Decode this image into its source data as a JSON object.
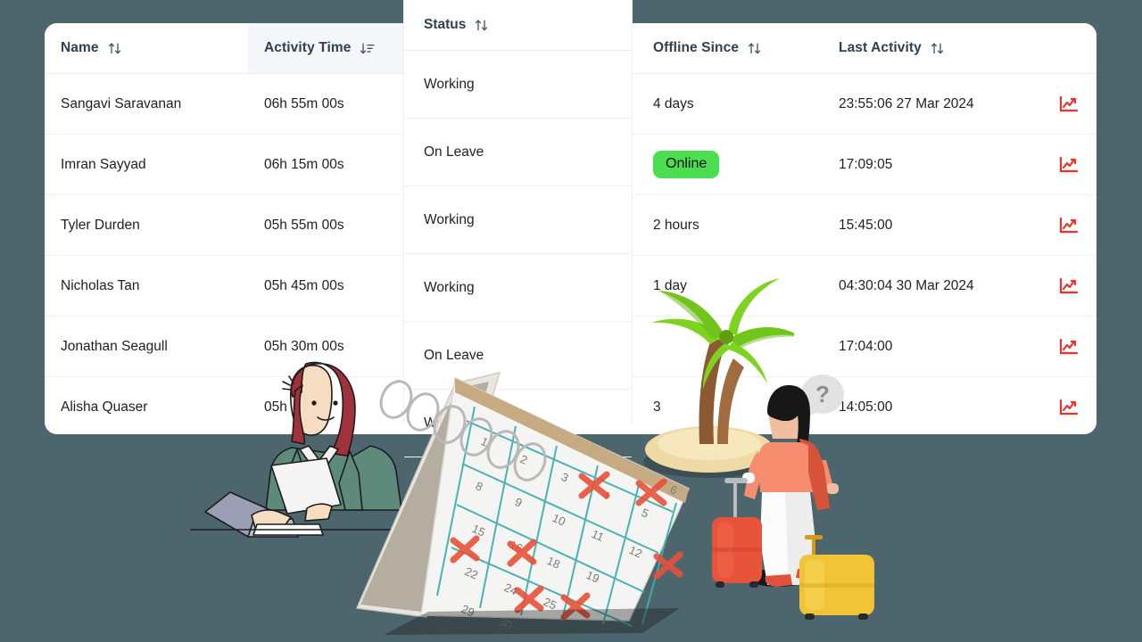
{
  "theme": {
    "background": "#4d666e",
    "card_background": "#ffffff",
    "header_text": "#2f4050",
    "header_tint": "#f4f6f9",
    "row_divider": "#eef1f5",
    "online_badge_bg": "#4ade50",
    "chart_icon_color": "#e8322a"
  },
  "table": {
    "columns": [
      {
        "key": "name",
        "label": "Name",
        "sort_icon": "sort-updown-icon",
        "tinted": false
      },
      {
        "key": "activity_time",
        "label": "Activity Time",
        "sort_icon": "sort-descending-icon",
        "tinted": true
      },
      {
        "key": "status",
        "label": "Status",
        "sort_icon": "sort-updown-icon",
        "tinted": false
      },
      {
        "key": "offline_since",
        "label": "Offline Since",
        "sort_icon": "sort-updown-icon",
        "tinted": false
      },
      {
        "key": "last_activity",
        "label": "Last Activity",
        "sort_icon": "sort-updown-icon",
        "tinted": false
      },
      {
        "key": "chart",
        "label": "",
        "sort_icon": "",
        "tinted": false
      }
    ],
    "rows": [
      {
        "name": "Sangavi Saravanan",
        "activity_time": "06h 55m 00s",
        "status": "Working",
        "offline_since": "4 days",
        "offline_is_badge": false,
        "last_activity": "23:55:06 27 Mar 2024",
        "chart_icon": "line-chart-icon"
      },
      {
        "name": "Imran Sayyad",
        "activity_time": "06h 15m 00s",
        "status": "On Leave",
        "offline_since": "Online",
        "offline_is_badge": true,
        "last_activity": "17:09:05",
        "chart_icon": "line-chart-icon"
      },
      {
        "name": "Tyler Durden",
        "activity_time": "05h 55m 00s",
        "status": "Working",
        "offline_since": "2 hours",
        "offline_is_badge": false,
        "last_activity": "15:45:00",
        "chart_icon": "line-chart-icon"
      },
      {
        "name": "Nicholas Tan",
        "activity_time": "05h 45m 00s",
        "status": "Working",
        "offline_since": "1 day",
        "offline_is_badge": false,
        "last_activity": "04:30:04 30 Mar 2024",
        "chart_icon": "line-chart-icon"
      },
      {
        "name": "Jonathan Seagull",
        "activity_time": "05h 30m 00s",
        "status": "On Leave",
        "offline_since": "",
        "offline_is_badge": false,
        "last_activity": "17:04:00",
        "chart_icon": "line-chart-icon"
      },
      {
        "name": "Alisha Quaser",
        "activity_time": "05h 05m",
        "status": "Working",
        "offline_since": "3",
        "offline_is_badge": false,
        "last_activity": "14:05:00",
        "chart_icon": "line-chart-icon"
      }
    ]
  },
  "status_panel": {
    "header_label": "Status",
    "sort_icon": "sort-updown-icon",
    "values": [
      "Working",
      "On Leave",
      "Working",
      "Working",
      "On Leave",
      "Wor"
    ]
  },
  "illustrations": [
    {
      "name": "woman-at-laptop-illustration",
      "description": "Woman with red hair in green blazer working at a laptop holding a document"
    },
    {
      "name": "desk-calendar-illustration",
      "description": "Tilted spiral desk calendar with red X marks on dates"
    },
    {
      "name": "palm-tree-island-illustration",
      "description": "Palm tree on a sandy island"
    },
    {
      "name": "traveler-with-luggage-illustration",
      "description": "Woman with handbag pulling a red suitcase beside a yellow suitcase with a question mark bubble"
    }
  ]
}
